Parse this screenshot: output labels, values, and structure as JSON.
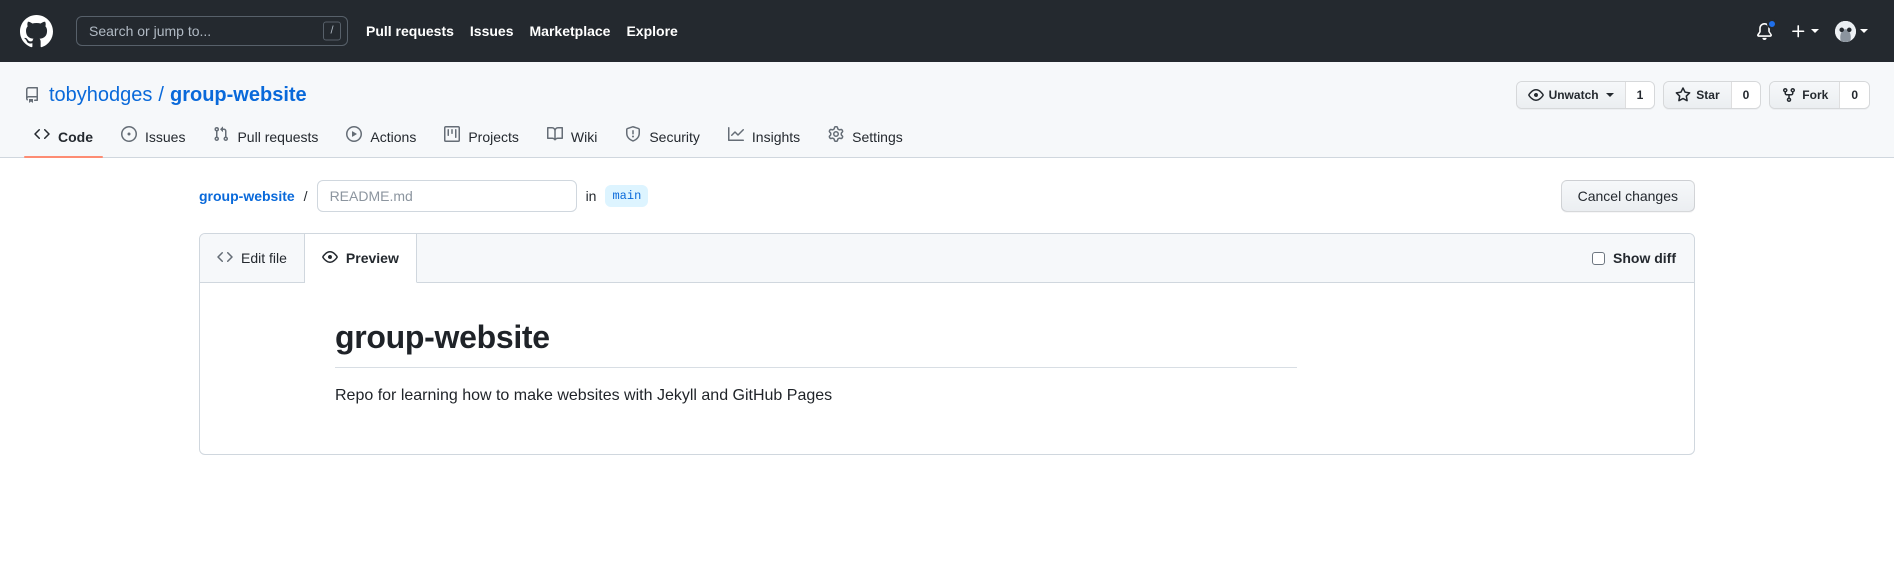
{
  "header": {
    "logo_icon": "github-mark-icon",
    "search": {
      "placeholder": "Search or jump to...",
      "value": "",
      "shortcut_key": "/"
    },
    "nav": [
      {
        "label": "Pull requests"
      },
      {
        "label": "Issues"
      },
      {
        "label": "Marketplace"
      },
      {
        "label": "Explore"
      }
    ],
    "notifications_icon": "bell-icon",
    "has_unread_notifications": true,
    "create_new_icon": "plus-icon",
    "account_icon": "avatar",
    "background_color": "#24292f"
  },
  "repo": {
    "icon": "repo-icon",
    "owner": "tobyhodges",
    "separator": "/",
    "name": "group-website",
    "link_color": "#0969da",
    "actions": {
      "watch": {
        "label": "Unwatch",
        "icon": "eye-icon",
        "count": "1"
      },
      "star": {
        "label": "Star",
        "icon": "star-icon",
        "count": "0"
      },
      "fork": {
        "label": "Fork",
        "icon": "fork-icon",
        "count": "0"
      }
    },
    "tabs": [
      {
        "label": "Code",
        "icon": "code-icon",
        "active": true
      },
      {
        "label": "Issues",
        "icon": "issue-opened-icon",
        "active": false
      },
      {
        "label": "Pull requests",
        "icon": "git-pull-request-icon",
        "active": false
      },
      {
        "label": "Actions",
        "icon": "play-icon",
        "active": false
      },
      {
        "label": "Projects",
        "icon": "project-icon",
        "active": false
      },
      {
        "label": "Wiki",
        "icon": "book-icon",
        "active": false
      },
      {
        "label": "Security",
        "icon": "shield-icon",
        "active": false
      },
      {
        "label": "Insights",
        "icon": "graph-icon",
        "active": false
      },
      {
        "label": "Settings",
        "icon": "gear-icon",
        "active": false
      }
    ],
    "active_tab_underline_color": "#fd8c73"
  },
  "editor": {
    "breadcrumb_repo": "group-website",
    "breadcrumb_separator": "/",
    "filename_placeholder": "README.md",
    "filename_value": "",
    "in_label": "in",
    "branch": "main",
    "branch_badge_bg": "#ddf4ff",
    "cancel_label": "Cancel changes",
    "tabs": [
      {
        "label": "Edit file",
        "icon": "code-icon",
        "active": false
      },
      {
        "label": "Preview",
        "icon": "eye-icon",
        "active": true
      }
    ],
    "show_diff": {
      "label": "Show diff",
      "checked": false
    }
  },
  "preview": {
    "heading": "group-website",
    "paragraph": "Repo for learning how to make websites with Jekyll and GitHub Pages"
  }
}
